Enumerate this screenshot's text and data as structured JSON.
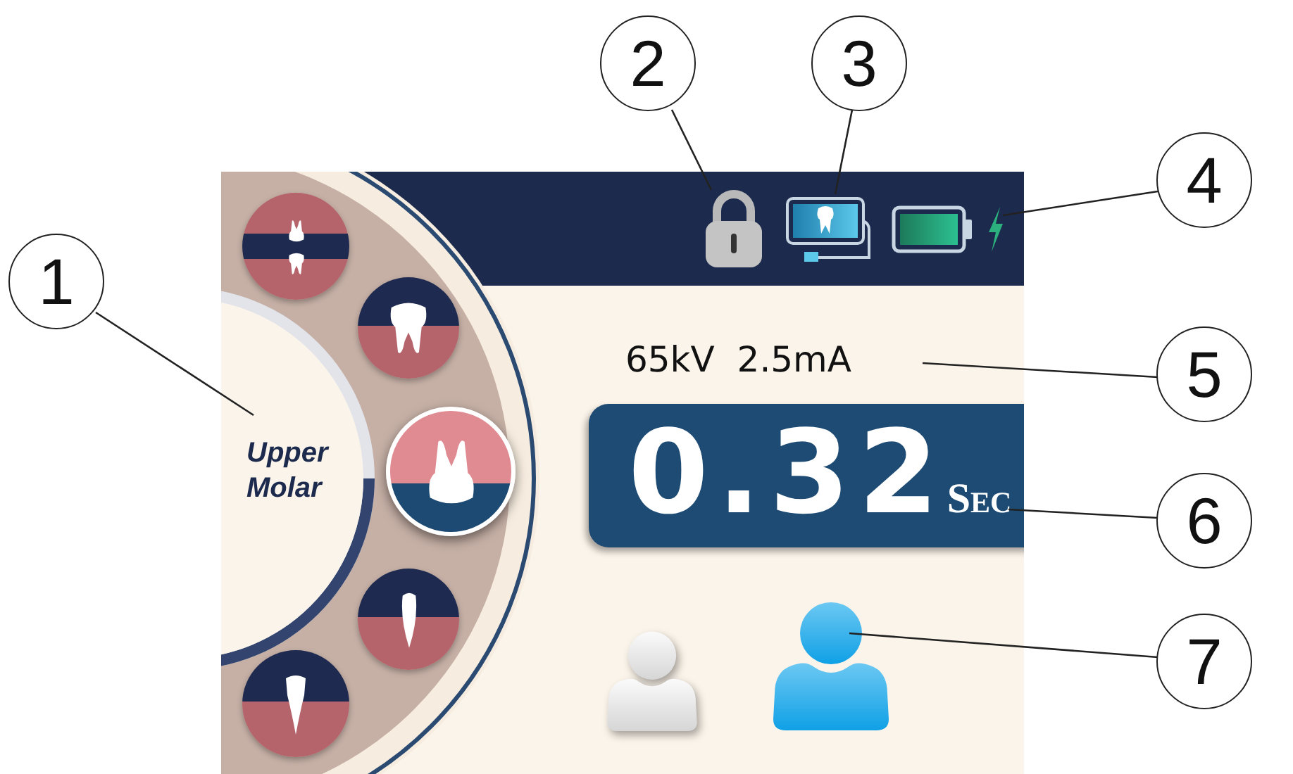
{
  "callouts": [
    {
      "number": "1"
    },
    {
      "number": "2"
    },
    {
      "number": "3"
    },
    {
      "number": "4"
    },
    {
      "number": "5"
    },
    {
      "number": "6"
    },
    {
      "number": "7"
    }
  ],
  "tooth_selector": {
    "label": "Upper Molar",
    "teeth": [
      {
        "kind": "bitewing",
        "selected": false
      },
      {
        "kind": "lower-molar",
        "selected": false
      },
      {
        "kind": "upper-molar",
        "selected": true
      },
      {
        "kind": "lower-canine",
        "selected": false
      },
      {
        "kind": "lower-incisor",
        "selected": false
      }
    ]
  },
  "status_bar": {
    "locked": true,
    "sensor_connected": true,
    "charging": true
  },
  "exposure": {
    "settings": "65kV  2.5mA",
    "time": "0.32",
    "unit": "Sec"
  },
  "patients": [
    {
      "kind": "child",
      "selected": false
    },
    {
      "kind": "adult",
      "selected": true
    }
  ]
}
